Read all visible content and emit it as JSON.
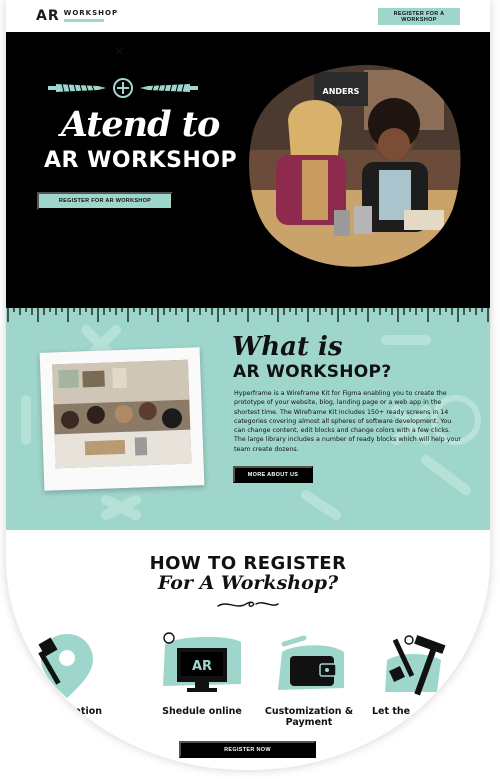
{
  "header": {
    "logo_letters": "AR",
    "logo_word": "WORKSHOP",
    "register_button": "REGISTER FOR A WORKSHOP"
  },
  "hero": {
    "title_script": "Atend to",
    "title_block": "AR WORKSHOP",
    "register_button": "REGISTER FOR AR WORKSHOP",
    "sign_text": "ANDERS"
  },
  "about": {
    "title_script": "What is",
    "title_block": "AR WORKSHOP?",
    "body": "Hyperframe is a Wireframe Kit for Figma enabling you to create the prototype of your website, blog, landing page or a web app in the shortest time. The Wireframe Kit includes 150+ ready screens in 14 categories covering almost all spheres of software development. You can change content, edit blocks and change colors with a few clicks. The large library includes a number of ready blocks which will help your team create dozens.",
    "more_button": "MORE ABOUT US"
  },
  "register": {
    "title_block": "HOW TO REGISTER",
    "title_script": "For A Workshop?",
    "steps": [
      {
        "label": "cation",
        "icon": "location-pin-icon"
      },
      {
        "label": "Shedule online",
        "icon": "computer-monitor-icon",
        "screen_text": "AR"
      },
      {
        "label": "Customization & Payment",
        "icon": "wallet-icon"
      },
      {
        "label": "Let the",
        "icon": "hammer-tools-icon"
      }
    ],
    "button": "REGISTER NOW"
  },
  "colors": {
    "mint": "#9fd6cb",
    "black": "#000000",
    "white": "#ffffff"
  }
}
